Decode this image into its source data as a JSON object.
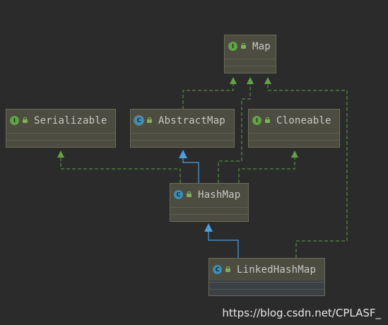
{
  "diagram": {
    "nodes": {
      "map": {
        "label": "Map",
        "kind": "interface",
        "badge": "I"
      },
      "serializable": {
        "label": "Serializable",
        "kind": "interface",
        "badge": "I"
      },
      "abstract_map": {
        "label": "AbstractMap",
        "kind": "abstract-class",
        "badge": "C"
      },
      "cloneable": {
        "label": "Cloneable",
        "kind": "interface",
        "badge": "I"
      },
      "hash_map": {
        "label": "HashMap",
        "kind": "class",
        "badge": "C"
      },
      "linked_hash_map": {
        "label": "LinkedHashMap",
        "kind": "class",
        "badge": "C"
      }
    },
    "edges": [
      {
        "from": "AbstractMap",
        "to": "Map",
        "type": "implements"
      },
      {
        "from": "HashMap",
        "to": "Map",
        "type": "implements"
      },
      {
        "from": "LinkedHashMap",
        "to": "Map",
        "type": "implements"
      },
      {
        "from": "HashMap",
        "to": "Serializable",
        "type": "implements"
      },
      {
        "from": "HashMap",
        "to": "Cloneable",
        "type": "implements"
      },
      {
        "from": "HashMap",
        "to": "AbstractMap",
        "type": "extends"
      },
      {
        "from": "LinkedHashMap",
        "to": "HashMap",
        "type": "extends"
      }
    ]
  },
  "colors": {
    "background": "#2b2b2b",
    "node_fill": "#4c4c40",
    "implements_edge": "#62a247",
    "extends_edge": "#4d9de0",
    "interface_badge": "#62a247",
    "class_badge": "#3d8eb5"
  },
  "icons": {
    "interface": "interface-icon",
    "class": "class-icon",
    "visibility": "lock-icon"
  },
  "watermark": "https://blog.csdn.net/CPLASF_"
}
